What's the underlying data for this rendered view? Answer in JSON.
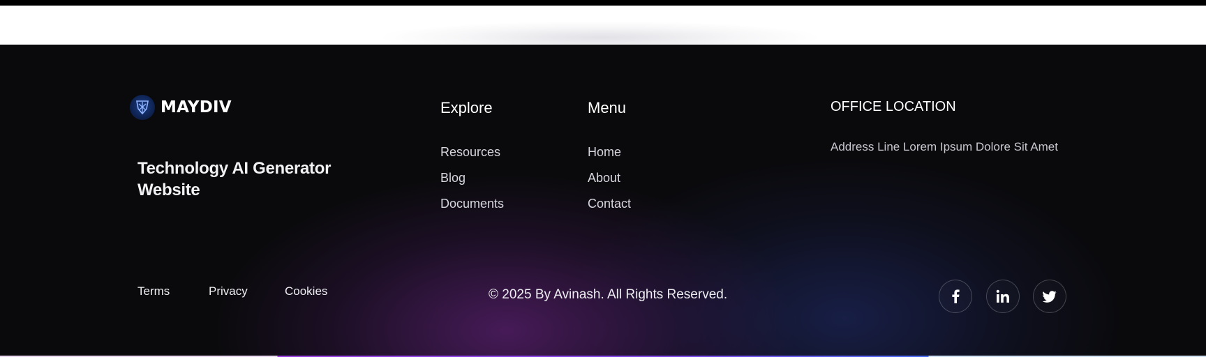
{
  "brand": {
    "name": "MAYDIV",
    "tagline": "Technology AI Generator Website"
  },
  "footer": {
    "explore": {
      "title": "Explore",
      "items": [
        "Resources",
        "Blog",
        "Documents"
      ]
    },
    "menu": {
      "title": "Menu",
      "items": [
        "Home",
        "About",
        "Contact"
      ]
    },
    "office": {
      "title": "OFFICE LOCATION",
      "address": "Address Line Lorem Ipsum Dolore Sit Amet"
    },
    "legal": [
      "Terms",
      "Privacy",
      "Cookies"
    ],
    "copyright": "© 2025 By Avinash. All Rights Reserved.",
    "social": [
      {
        "icon": "facebook-icon"
      },
      {
        "icon": "linkedin-icon"
      },
      {
        "icon": "twitter-icon"
      }
    ]
  },
  "colors": {
    "background": "#0a0a0c",
    "glow_purple": "#7a2896",
    "glow_blue": "#28378c",
    "accent_line": "#7f46e6"
  }
}
